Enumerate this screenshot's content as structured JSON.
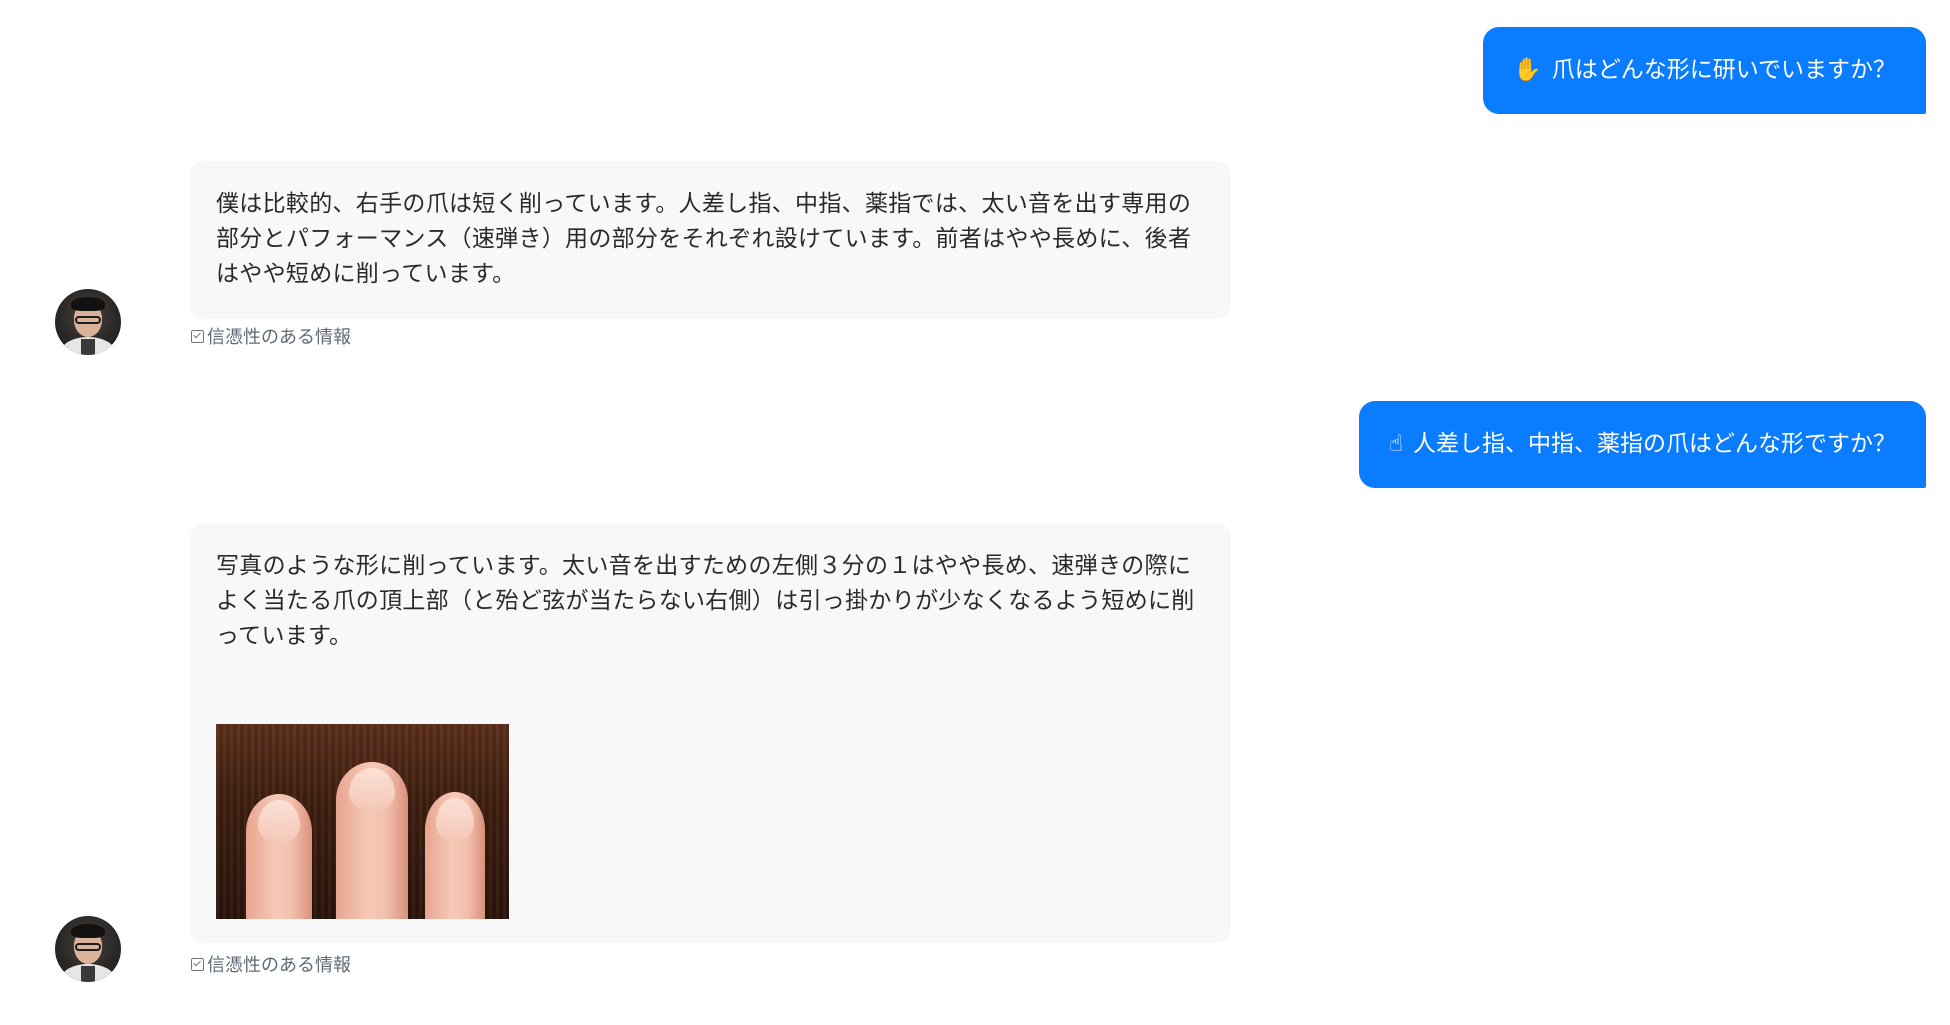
{
  "messages": {
    "q1": {
      "emoji": "✋",
      "text": "爪はどんな形に研いでいますか？"
    },
    "a1": {
      "text": "僕は比較的、右手の爪は短く削っています。人差し指、中指、薬指では、太い音を出す専用の部分とパフォーマンス（速弾き）用の部分をそれぞれ設けています。前者はやや長めに、後者はやや短めに削っています。",
      "trust_label": "信憑性のある情報"
    },
    "q2": {
      "emoji": "☝",
      "text": "人差し指、中指、薬指の爪はどんな形ですか？"
    },
    "a2": {
      "text": "写真のような形に削っています。太い音を出すための左側３分の１はやや長め、速弾きの際によく当たる爪の頂上部（と殆ど弦が当たらない右側）は引っ掛かりが少なくなるよう短めに削っています。",
      "trust_label": "信憑性のある情報"
    }
  },
  "colors": {
    "user_bubble": "#0a7cff",
    "bot_bubble": "#f6f8fa",
    "trust_text": "#5f6b76"
  }
}
